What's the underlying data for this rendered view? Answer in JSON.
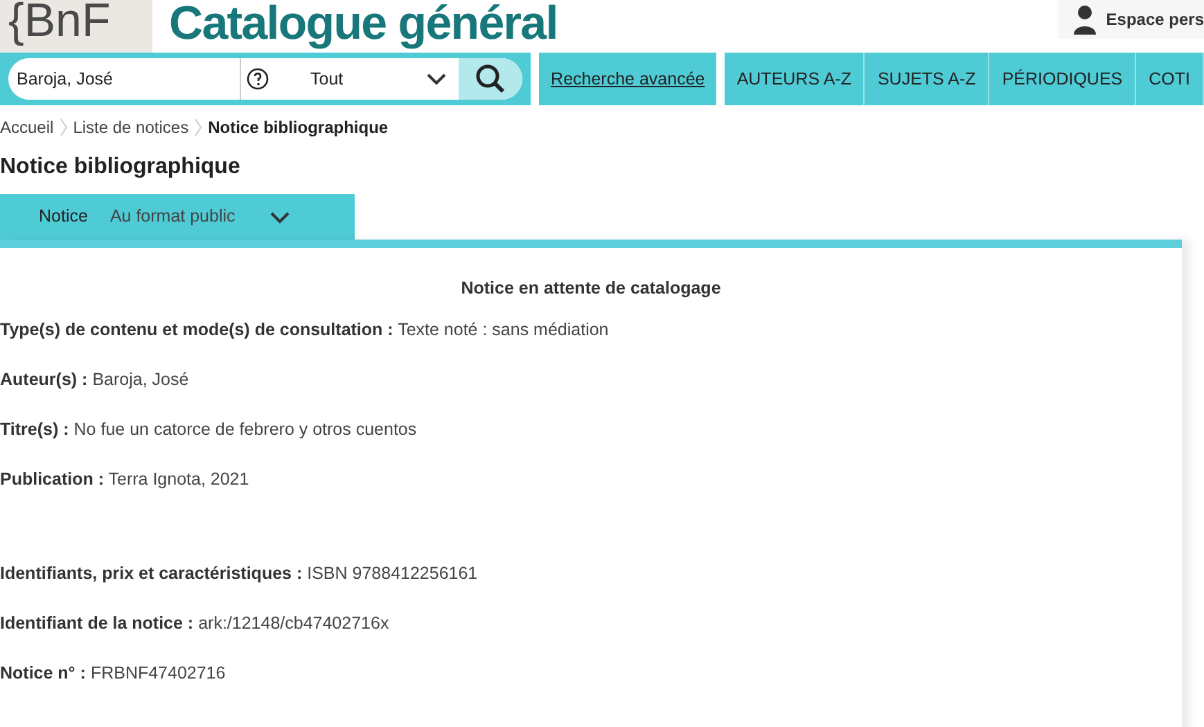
{
  "header": {
    "logo": "{BnF",
    "title": "Catalogue général",
    "account": "Espace pers"
  },
  "search": {
    "value": "Baroja, José",
    "scope": "Tout"
  },
  "advanced_search": "Recherche avancée",
  "nav": [
    "AUTEURS A-Z",
    "SUJETS A-Z",
    "PÉRIODIQUES",
    "COTI"
  ],
  "breadcrumb": [
    {
      "label": "Accueil",
      "current": false
    },
    {
      "label": "Liste de notices",
      "current": false
    },
    {
      "label": "Notice bibliographique",
      "current": true
    }
  ],
  "heading": "Notice bibliographique",
  "tabs": [
    {
      "label": "Notice",
      "selected": true
    },
    {
      "label": "Au format public",
      "selected": false
    }
  ],
  "notice": {
    "status": "Notice en attente de catalogage",
    "fields": [
      {
        "label": "Type(s) de contenu et mode(s) de consultation :",
        "value": "Texte noté : sans médiation"
      },
      {
        "label": "Auteur(s) :",
        "value": "Baroja, José"
      },
      {
        "label": "Titre(s) :",
        "value": "No fue un catorce de febrero y otros cuentos"
      },
      {
        "label": "Publication :",
        "value": "Terra Ignota, 2021"
      }
    ],
    "identifiers": [
      {
        "label": "Identifiants, prix et caractéristiques :",
        "value": "ISBN 9788412256161"
      },
      {
        "label": "Identifiant de la notice  :",
        "value": "ark:/12148/cb47402716x"
      },
      {
        "label": "Notice n° :",
        "value": "FRBNF47402716"
      }
    ]
  }
}
